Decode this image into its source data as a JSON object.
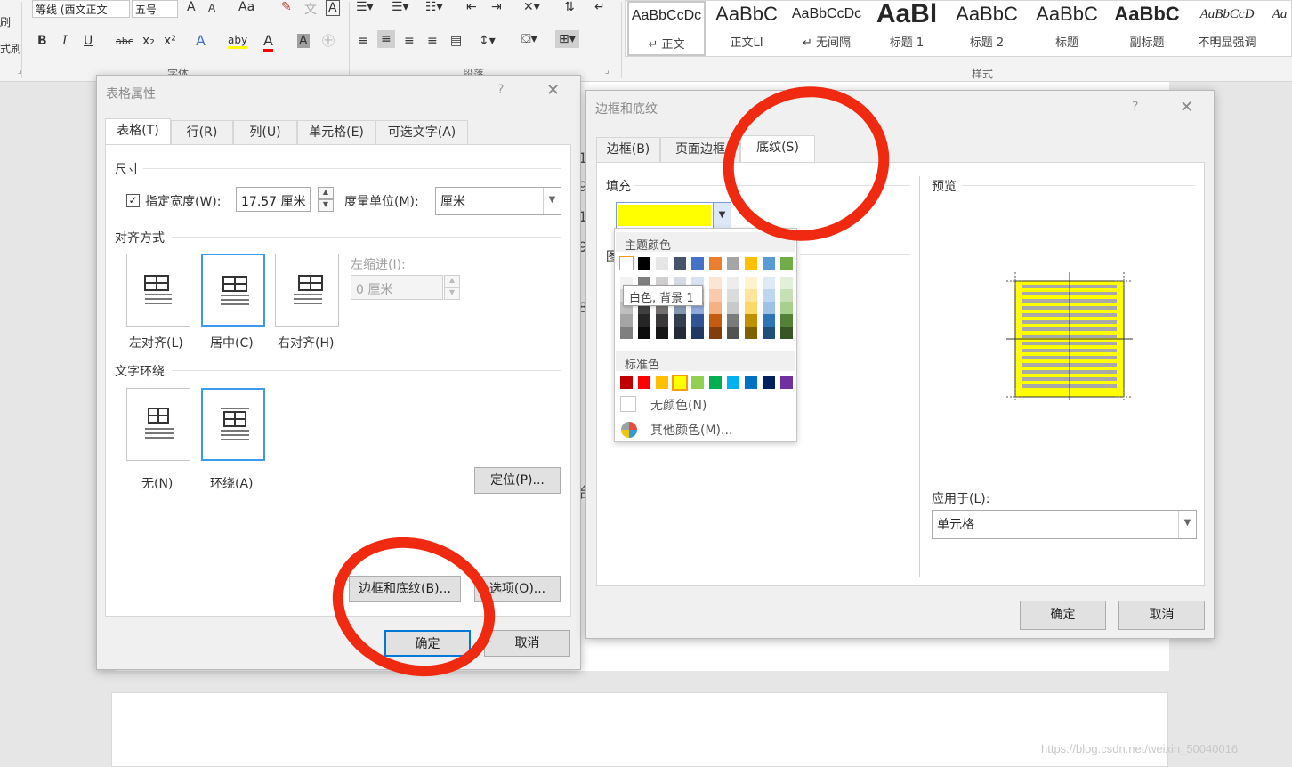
{
  "ribbon": {
    "left_partial": [
      "刷",
      "式刷"
    ],
    "font_name": "等线 (西文正文",
    "font_size": "五号",
    "font_btns": [
      "A",
      "A",
      "Aa"
    ],
    "font_row2": [
      "B",
      "I",
      "U",
      "abc",
      "x₂",
      "x²",
      "A",
      "aby",
      "A",
      "A"
    ],
    "group_font": "字体",
    "group_paragraph": "段落",
    "group_styles": "样式",
    "styles": [
      {
        "sample": "AaBbCcDc",
        "name": "↵ 正文"
      },
      {
        "sample": "AaBbC",
        "name": "正文LI"
      },
      {
        "sample": "AaBbCcDc",
        "name": "↵ 无间隔"
      },
      {
        "sample": "AaBl",
        "name": "标题 1"
      },
      {
        "sample": "AaBbC",
        "name": "标题 2"
      },
      {
        "sample": "AaBbC",
        "name": "标题"
      },
      {
        "sample": "AaBbC",
        "name": "副标题"
      },
      {
        "sample": "AaBbCcD",
        "name": "不明显强调"
      },
      {
        "sample": "Aa",
        "name": ""
      }
    ]
  },
  "doc_fragments": [
    "1",
    "9",
    "1",
    "9",
    "8",
    "台"
  ],
  "table_props": {
    "title": "表格属性",
    "help": "?",
    "close": "✕",
    "tabs": [
      "表格(T)",
      "行(R)",
      "列(U)",
      "单元格(E)",
      "可选文字(A)"
    ],
    "size_section": "尺寸",
    "width_label": "指定宽度(W):",
    "width_checked": true,
    "width_value": "17.57 厘米",
    "unit_label": "度量单位(M):",
    "unit_value": "厘米",
    "align_section": "对齐方式",
    "align_options": [
      "左对齐(L)",
      "居中(C)",
      "右对齐(H)"
    ],
    "align_selected": "居中(C)",
    "indent_label": "左缩进(I):",
    "indent_value": "0 厘米",
    "wrap_section": "文字环绕",
    "wrap_options": [
      "无(N)",
      "环绕(A)"
    ],
    "wrap_selected": "环绕(A)",
    "position_btn": "定位(P)...",
    "borders_btn": "边框和底纹(B)...",
    "options_btn": "选项(O)...",
    "ok": "确定",
    "cancel": "取消"
  },
  "borders_dialog": {
    "title": "边框和底纹",
    "help": "?",
    "close": "✕",
    "tabs": [
      "边框(B)",
      "页面边框",
      "底纹(S)"
    ],
    "active_tab": "底纹(S)",
    "fill_section": "填充",
    "fill_color": "#ffff00",
    "pattern_partial": "图",
    "preview_section": "预览",
    "apply_label": "应用于(L):",
    "apply_value": "单元格",
    "ok": "确定",
    "cancel": "取消"
  },
  "color_palette": {
    "theme_header": "主题颜色",
    "standard_header": "标准色",
    "theme_top": [
      "#ffffff",
      "#000000",
      "#e7e6e6",
      "#44546a",
      "#4472c4",
      "#ed7d31",
      "#a5a5a5",
      "#ffc000",
      "#5b9bd5",
      "#70ad47"
    ],
    "theme_shades": [
      [
        "#f2f2f2",
        "#7f7f7f",
        "#d0cece",
        "#d6dce4",
        "#d9e2f3",
        "#fbe5d5",
        "#ededed",
        "#fff2cc",
        "#deebf6",
        "#e2efd9"
      ],
      [
        "#d8d8d8",
        "#595959",
        "#aeabab",
        "#adb9ca",
        "#b4c6e7",
        "#f7cbac",
        "#dbdbdb",
        "#fee599",
        "#bdd7ee",
        "#c5e0b3"
      ],
      [
        "#bfbfbf",
        "#3f3f3f",
        "#757070",
        "#8496b0",
        "#8eaadb",
        "#f4b183",
        "#c9c9c9",
        "#ffd965",
        "#9cc3e5",
        "#a8d08d"
      ],
      [
        "#a5a5a5",
        "#262626",
        "#3a3838",
        "#323f4f",
        "#2f5496",
        "#c55a11",
        "#7b7b7b",
        "#bf9000",
        "#2e75b5",
        "#538135"
      ],
      [
        "#7f7f7f",
        "#0c0c0c",
        "#171616",
        "#222a35",
        "#1f3864",
        "#833c0b",
        "#525252",
        "#7f6000",
        "#1e4e79",
        "#375623"
      ]
    ],
    "standard": [
      "#c00000",
      "#ff0000",
      "#ffc000",
      "#ffff00",
      "#92d050",
      "#00b050",
      "#00b0f0",
      "#0070c0",
      "#002060",
      "#7030a0"
    ],
    "standard_selected": "#ffff00",
    "tooltip": "白色, 背景 1",
    "no_color": "无颜色(N)",
    "more_colors": "其他颜色(M)..."
  },
  "watermark": "https://blog.csdn.net/weixin_50040016"
}
